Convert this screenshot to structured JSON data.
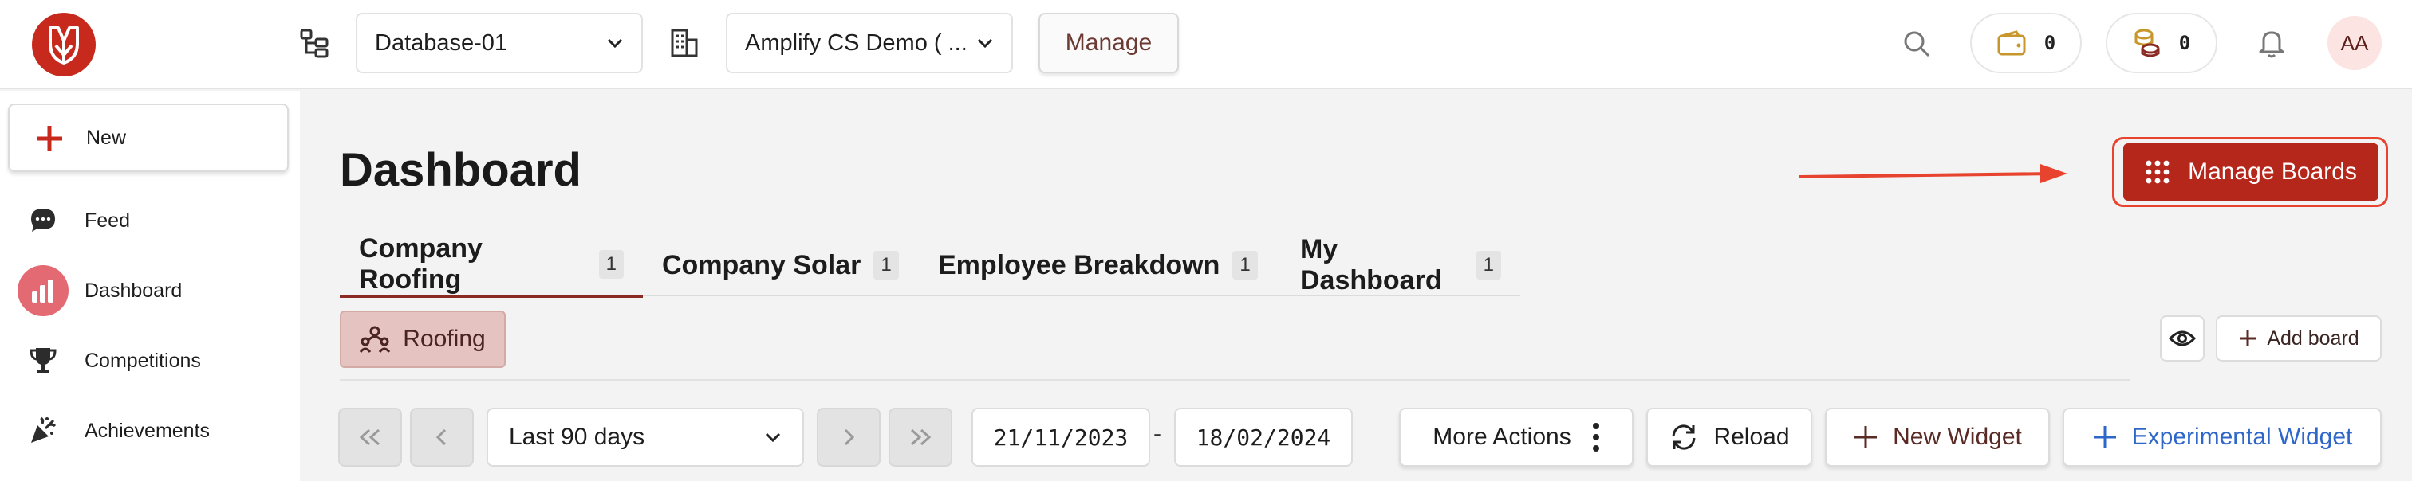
{
  "topbar": {
    "database_select": "Database-01",
    "org_select": "Amplify CS Demo ( ...",
    "manage_label": "Manage",
    "wallet_count": "0",
    "coins_count": "0",
    "avatar_initials": "AA"
  },
  "sidebar": {
    "new_label": "New",
    "items": [
      {
        "label": "Feed",
        "icon": "chat-bubble-icon"
      },
      {
        "label": "Dashboard",
        "icon": "bar-chart-icon"
      },
      {
        "label": "Competitions",
        "icon": "trophy-icon"
      },
      {
        "label": "Achievements",
        "icon": "party-popper-icon"
      }
    ]
  },
  "main": {
    "title": "Dashboard",
    "manage_boards_label": "Manage Boards",
    "tabs": [
      {
        "label": "Company Roofing",
        "count": "1"
      },
      {
        "label": "Company Solar",
        "count": "1"
      },
      {
        "label": "Employee Breakdown",
        "count": "1"
      },
      {
        "label": "My Dashboard",
        "count": "1"
      }
    ],
    "board_chip": "Roofing",
    "add_board_label": "Add board",
    "controls": {
      "range_select": "Last 90 days",
      "start_date": "21/11/2023",
      "end_date": "18/02/2024",
      "date_separator": "-",
      "more_actions": "More Actions",
      "reload": "Reload",
      "new_widget": "New Widget",
      "experimental_widget": "Experimental Widget"
    }
  },
  "colors": {
    "brand_red": "#c8291d",
    "manage_boards_bg": "#b6271b",
    "annotation_red": "#e8432e",
    "accent_blue": "#2f67c9"
  }
}
